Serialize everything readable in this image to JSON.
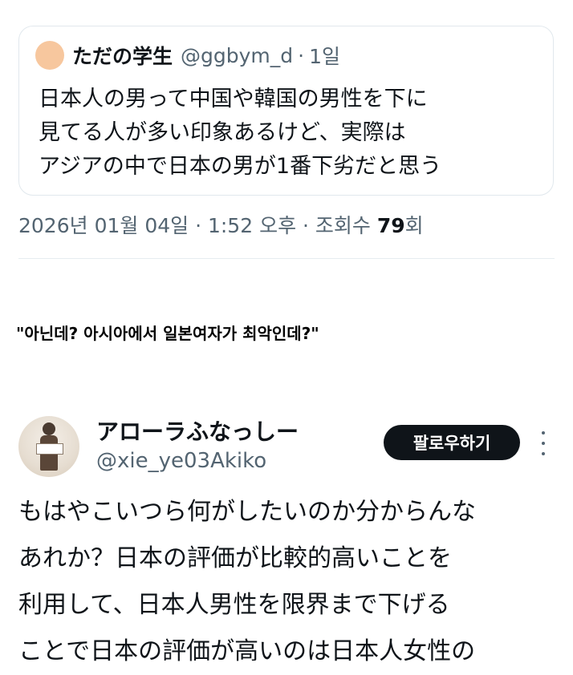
{
  "quoted_tweet": {
    "name": "ただの学生",
    "handle": "@ggbym_d",
    "separator": "·",
    "time": "1일",
    "lines": [
      "日本人の男って中国や韓国の男性を下に",
      "見てる人が多い印象あるけど、実際は",
      "アジアの中で日本の男が1番下劣だと思う"
    ],
    "avatar_color": "#f7c79e"
  },
  "meta": {
    "text": "2026년 01월 04일 · 1:52 오후 · 조회수 ",
    "views": "79",
    "views_suffix": "회"
  },
  "caption": "\"아닌데? 아시아에서 일본여자가 최악인데?\"",
  "reply_tweet": {
    "name": "アローラふなっしー",
    "handle": "@xie_ye03Akiko",
    "follow_label": "팔로우하기",
    "lines": [
      "もはやこいつら何がしたいのか分からんな",
      "あれか？日本の評価が比較的高いことを",
      "利用して、日本人男性を限界まで下げる",
      "ことで日本の評価が高いのは日本人女性の"
    ]
  },
  "colors": {
    "text_primary": "#0f1419",
    "text_secondary": "#536471",
    "border": "#e1e8ed",
    "button_bg": "#0f1419"
  },
  "icons": {
    "more": "more-vertical-icon"
  }
}
